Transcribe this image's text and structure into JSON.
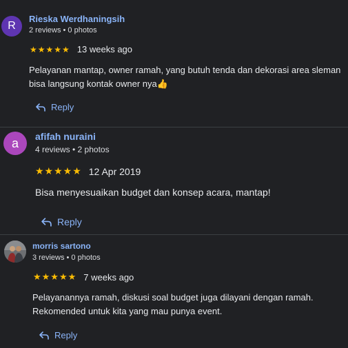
{
  "reviews": [
    {
      "avatar_letter": "R",
      "avatar_color": "#5e35b1",
      "name": "Rieska Werdhaningsih",
      "meta": "2 reviews • 0 photos",
      "stars": "★★★★★",
      "date": "13 weeks ago",
      "text": "Pelayanan mantap, owner ramah, yang butuh tenda dan dekorasi area sleman bisa langsung kontak owner nya👍",
      "reply_label": "Reply"
    },
    {
      "avatar_letter": "a",
      "avatar_color": "#ab47bc",
      "name": "afifah nuraini",
      "meta": "4 reviews • 2 photos",
      "stars": "★★★★★",
      "date": "12 Apr 2019",
      "text": "Bisa menyesuaikan budget dan konsep acara, mantap!",
      "reply_label": "Reply"
    },
    {
      "avatar_icon": "user-photo-icon",
      "name": "morris sartono",
      "meta": "3 reviews • 0 photos",
      "stars": "★★★★★",
      "date": "7 weeks ago",
      "text": "Pelayanannya ramah, diskusi soal budget juga dilayani dengan ramah. Rekomended untuk kita yang mau punya event.",
      "reply_label": "Reply"
    }
  ],
  "colors": {
    "background": "#202124",
    "link": "#8ab4f8",
    "star": "#fbbc04",
    "text": "#e8eaed"
  }
}
